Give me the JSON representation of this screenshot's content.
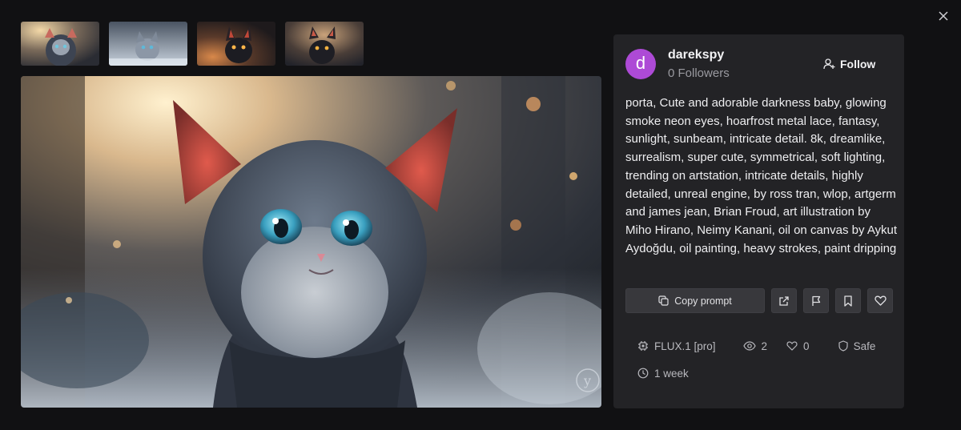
{
  "thumbnails": [
    {
      "alt": "cat-in-hood"
    },
    {
      "alt": "grey-kitten-snow"
    },
    {
      "alt": "dark-cat-orange-eyes"
    },
    {
      "alt": "dark-cat-gold-eyes"
    }
  ],
  "author": {
    "avatar_letter": "d",
    "avatar_color": "#ad4ad6",
    "name": "darekspy",
    "followers": "0 Followers"
  },
  "follow_label": "Follow",
  "prompt": "porta, Cute and adorable darkness baby, glowing smoke neon eyes, hoarfrost metal lace, fantasy, sunlight, sunbeam, intricate detail. 8k, dreamlike, surrealism, super cute, symmetrical, soft lighting, trending on artstation, intricate details, highly detailed, unreal engine, by ross tran, wlop, artgerm and james jean, Brian Froud, art illustration by Miho Hirano, Neimy Kanani, oil on canvas by Aykut Aydoğdu, oil painting, heavy strokes, paint dripping",
  "copy_label": "Copy prompt",
  "meta": {
    "model": "FLUX.1 [pro]",
    "views": "2",
    "likes": "0",
    "rating": "Safe",
    "age": "1 week"
  },
  "icons": [
    "close-icon",
    "user-plus-icon",
    "copy-icon",
    "external-link-icon",
    "flag-icon",
    "bookmark-icon",
    "heart-icon",
    "chip-icon",
    "eye-icon",
    "shield-icon",
    "clock-icon"
  ]
}
